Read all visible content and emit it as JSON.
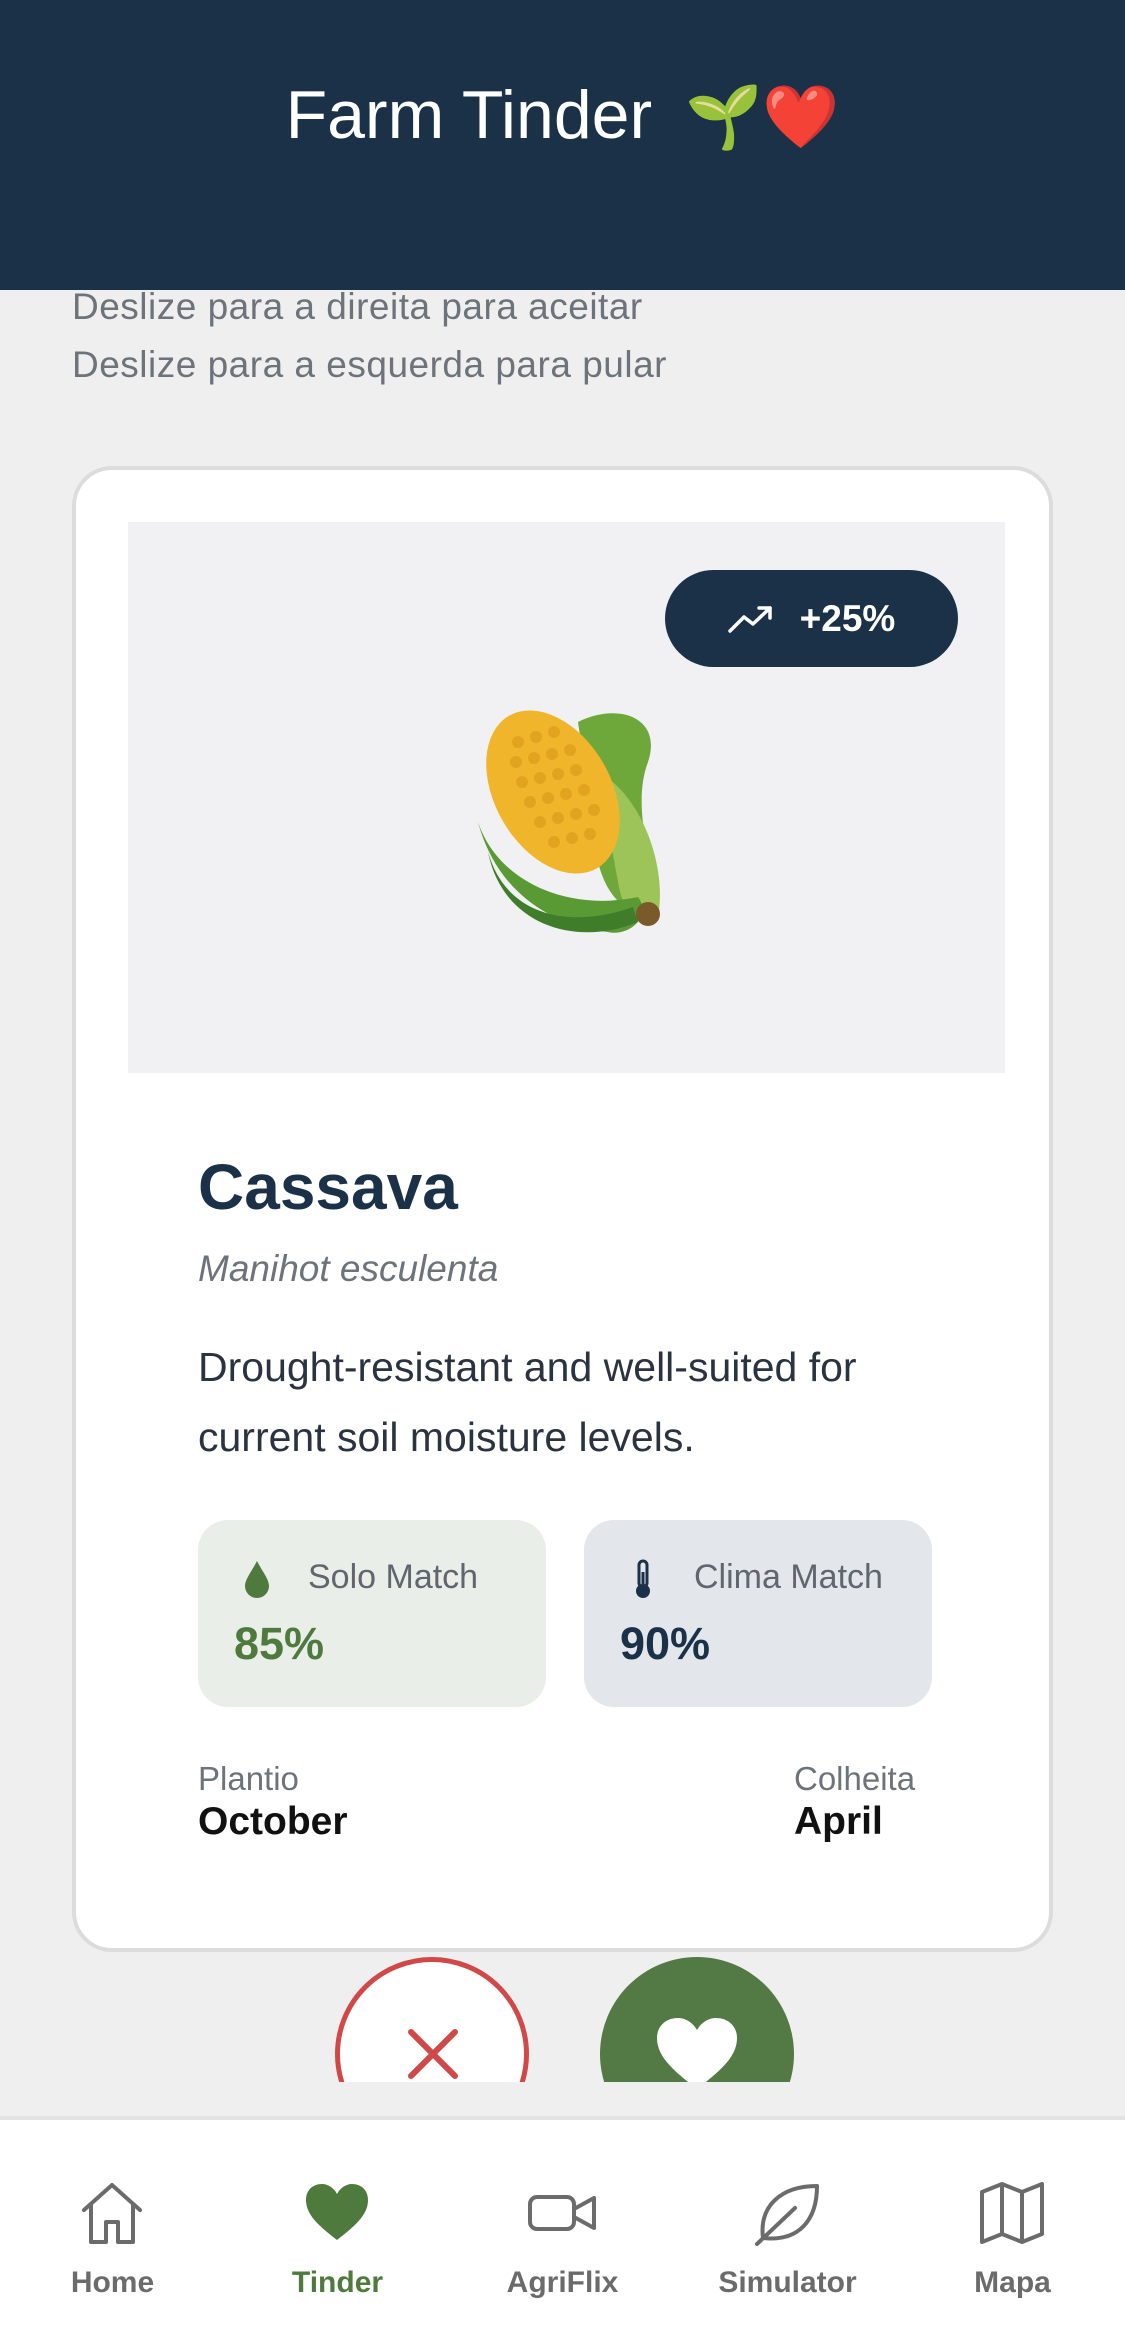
{
  "header": {
    "title": "Farm Tinder",
    "emoji": "🌱❤️"
  },
  "hints": {
    "right": "Deslize para a direita para aceitar",
    "left": "Deslize para a esquerda para pular"
  },
  "card": {
    "trend_badge": {
      "icon": "trending-up-icon",
      "value": "+25%"
    },
    "image_icon": "corn-icon",
    "name": "Cassava",
    "scientific_name": "Manihot esculenta",
    "description": "Drought-resistant and well-suited for current soil moisture levels.",
    "solo_match": {
      "icon": "droplet-icon",
      "label": "Solo Match",
      "value": "85%"
    },
    "clima_match": {
      "icon": "thermometer-icon",
      "label": "Clima Match",
      "value": "90%"
    },
    "plantio": {
      "label": "Plantio",
      "value": "October"
    },
    "colheita": {
      "label": "Colheita",
      "value": "April"
    }
  },
  "actions": {
    "skip_icon": "close-icon",
    "like_icon": "heart-icon"
  },
  "tabbar": {
    "active": "Tinder",
    "items": [
      {
        "label": "Home",
        "icon": "home-icon"
      },
      {
        "label": "Tinder",
        "icon": "heart-icon"
      },
      {
        "label": "AgriFlix",
        "icon": "video-icon"
      },
      {
        "label": "Simulator",
        "icon": "leaf-icon"
      },
      {
        "label": "Mapa",
        "icon": "map-icon"
      }
    ]
  },
  "colors": {
    "header_bg": "#1a3147",
    "accent_green": "#537a44",
    "skip_red": "#d14848",
    "page_bg": "#efefef"
  }
}
